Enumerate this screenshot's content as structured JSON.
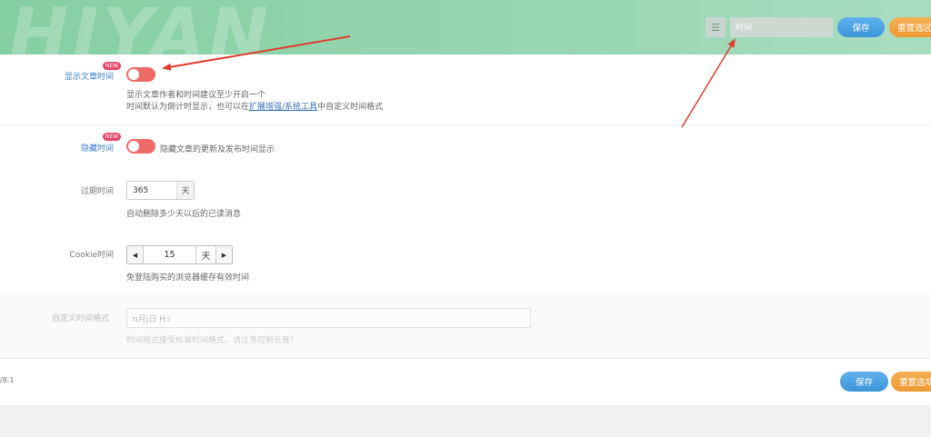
{
  "header": {
    "watermark": "HIYAN",
    "search_placeholder": "时间",
    "save_label": "保存",
    "reset_label": "重置选区"
  },
  "settings": {
    "show_time": {
      "label": "显示文章时间",
      "badge": "NEW",
      "enabled": false,
      "desc_line1": "显示文章作者和时间建议至少开启一个",
      "desc_line2_pre": "时间默认为倒计时显示，也可以在",
      "desc_line2_link": "扩展增强/系统工具",
      "desc_line2_post": "中自定义时间格式"
    },
    "hide_time": {
      "label": "隐藏时间",
      "badge": "NEW",
      "enabled": false,
      "desc": "隐藏文章的更新及发布时间显示"
    },
    "expire": {
      "label": "过期时间",
      "value": "365",
      "unit": "天",
      "desc": "自动删除多少天以后的已读消息"
    },
    "cookie": {
      "label": "Cookie时间",
      "value": "15",
      "unit": "天",
      "desc": "免登陆购买的浏览器缓存有效时间"
    },
    "custom_format": {
      "label": "自定义时间格式",
      "value": "n月j日 H:i",
      "desc": "时间格式接受标准时间格式，请注意控制长度！"
    }
  },
  "footer": {
    "version": "/8.1",
    "save_label": "保存",
    "reset_label": "重置选项"
  },
  "colors": {
    "header_gradient_start": "#86cfa3",
    "toggle": "#ee6a66",
    "save_button": "#4aa3e4",
    "reset_button": "#f0a03a",
    "badge": "#e9466a",
    "arrow": "#e23b2e"
  }
}
